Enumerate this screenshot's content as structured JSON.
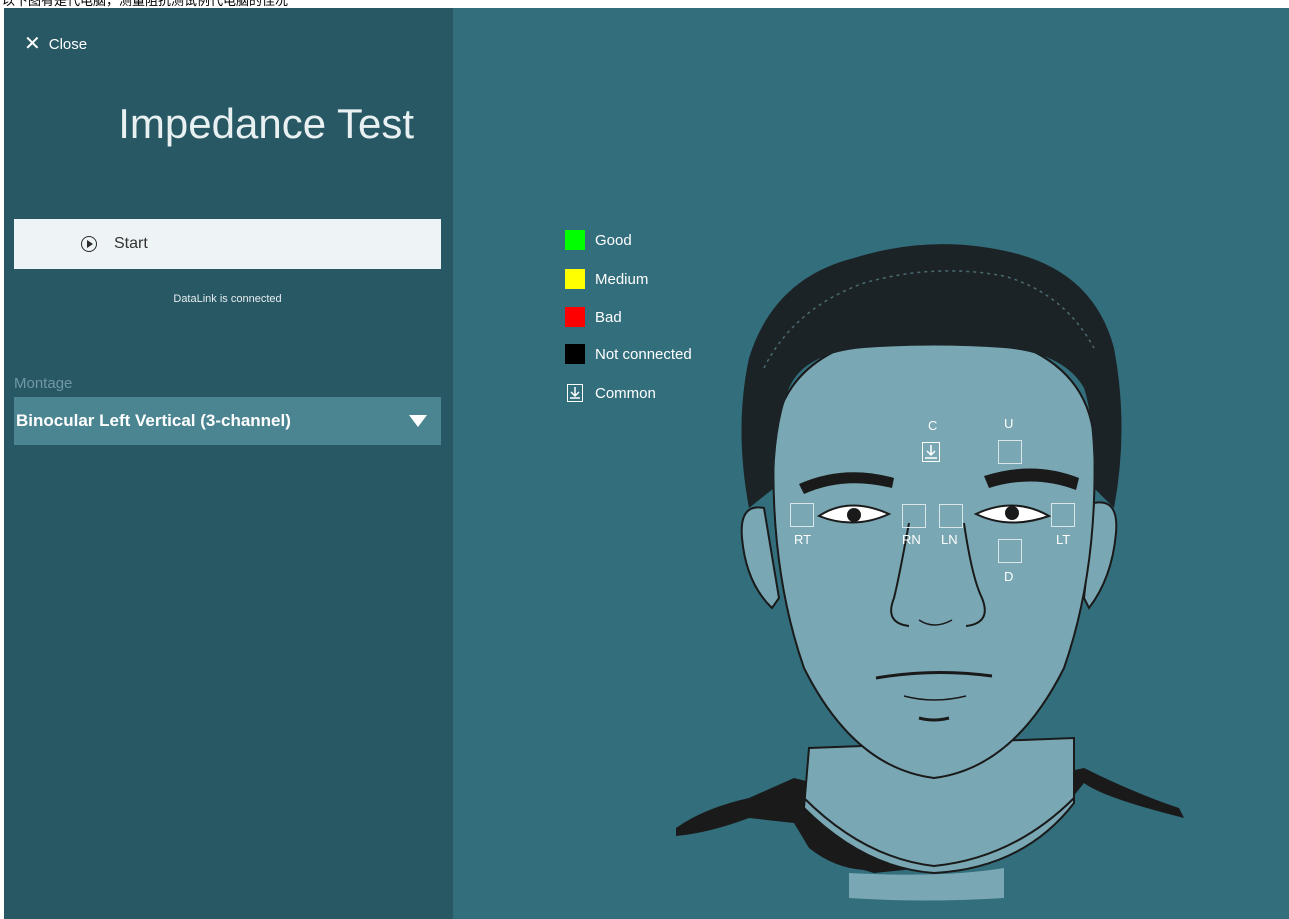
{
  "caption": "以下图有是代电脑，测量阻抗测试例代电脑的佳况",
  "window": {
    "close_label": "Close",
    "title": "Impedance Test",
    "start_label": "Start",
    "status_text": "DataLink is connected",
    "montage_label": "Montage",
    "montage_value": "Binocular Left Vertical (3-channel)"
  },
  "legend": [
    {
      "label": "Good",
      "color": "#00ff00"
    },
    {
      "label": "Medium",
      "color": "#ffff00"
    },
    {
      "label": "Bad",
      "color": "#ff0000"
    },
    {
      "label": "Not connected",
      "color": "#000000"
    },
    {
      "label": "Common",
      "icon": "ground-arrow-icon"
    }
  ],
  "electrodes": {
    "C": "C",
    "U": "U",
    "RT": "RT",
    "RN": "RN",
    "LN": "LN",
    "LT": "LT",
    "D": "D"
  },
  "colors": {
    "background": "#336e7c",
    "sidebar": "#295865",
    "face": "#79a8b4",
    "montage_select": "#4b8592"
  }
}
